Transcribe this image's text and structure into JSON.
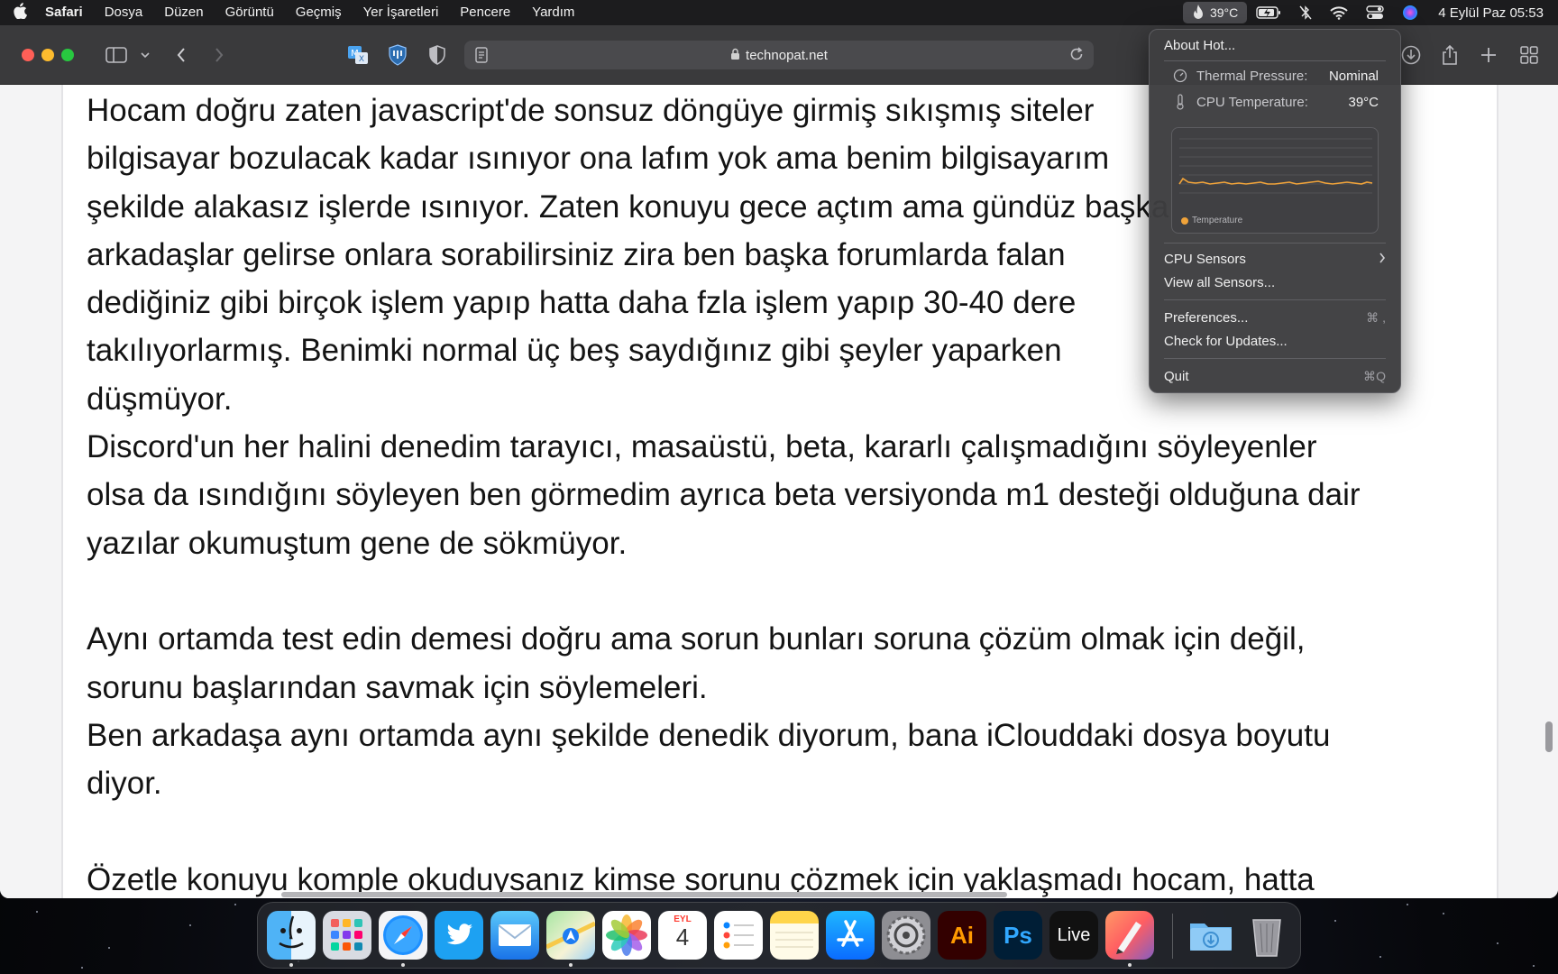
{
  "menubar": {
    "app_name": "Safari",
    "items": [
      "Dosya",
      "Düzen",
      "Görüntü",
      "Geçmiş",
      "Yer İşaretleri",
      "Pencere",
      "Yardım"
    ],
    "temperature": "39°C",
    "clock": "4 Eylül Paz  05:53"
  },
  "toolbar": {
    "url": "technopat.net"
  },
  "article": {
    "lines": [
      "Hocam doğru zaten javascript'de sonsuz döngüye girmiş sıkışmış siteler",
      "bilgisayar bozulacak kadar ısınıyor ona lafım yok ama benim bilgisayarım",
      "şekilde alakasız işlerde ısınıyor. Zaten konuyu gece açtım ama gündüz başka",
      "arkadaşlar gelirse onlara sorabilirsiniz zira ben başka forumlarda falan",
      "dediğiniz gibi birçok işlem yapıp hatta daha fzla işlem yapıp 30-40 dere",
      "takılıyorlarmış. Benimki normal üç beş saydığınız gibi şeyler yaparken",
      "düşmüyor.",
      "Discord'un her halini denedim tarayıcı, masaüstü, beta, kararlı çalışmadığını söyleyenler",
      "olsa da ısındığını söyleyen ben görmedim ayrıca beta versiyonda m1 desteği olduğuna dair",
      "yazılar okumuştum gene de sökmüyor.",
      "",
      "Aynı ortamda test edin demesi doğru ama sorun bunları soruna çözüm olmak için değil,",
      "sorunu başlarından savmak için söylemeleri.",
      "Ben arkadaşa aynı ortamda aynı şekilde denedik diyorum, bana iClouddaki dosya boyutu",
      "diyor.",
      "",
      "Özetle konuyu komple okuduysanız kimse sorunu çözmek için yaklaşmadı hocam, hatta"
    ]
  },
  "dropdown": {
    "about": "About Hot...",
    "thermal_label": "Thermal Pressure:",
    "thermal_value": "Nominal",
    "cpu_temp_label": "CPU Temperature:",
    "cpu_temp_value": "39°C",
    "graph_legend": "Temperature",
    "cpu_sensors": "CPU Sensors",
    "view_all": "View all Sensors...",
    "preferences": "Preferences...",
    "preferences_shortcut": "⌘ ,",
    "check_updates": "Check for Updates...",
    "quit": "Quit",
    "quit_shortcut": "⌘Q",
    "series_color": "#f0a33a"
  },
  "dock": {
    "apps": [
      "Finder",
      "Launchpad",
      "Safari",
      "Twitter",
      "Mail",
      "Maps",
      "Photos",
      "Calendar",
      "Reminders",
      "Notes",
      "App Store",
      "System Preferences",
      "Illustrator",
      "Photoshop",
      "Live",
      "Pixelmator",
      "Downloads",
      "Trash"
    ],
    "calendar_month": "EYL",
    "calendar_day": "4",
    "illustrator_label": "Ai",
    "photoshop_label": "Ps",
    "live_label": "Live"
  }
}
